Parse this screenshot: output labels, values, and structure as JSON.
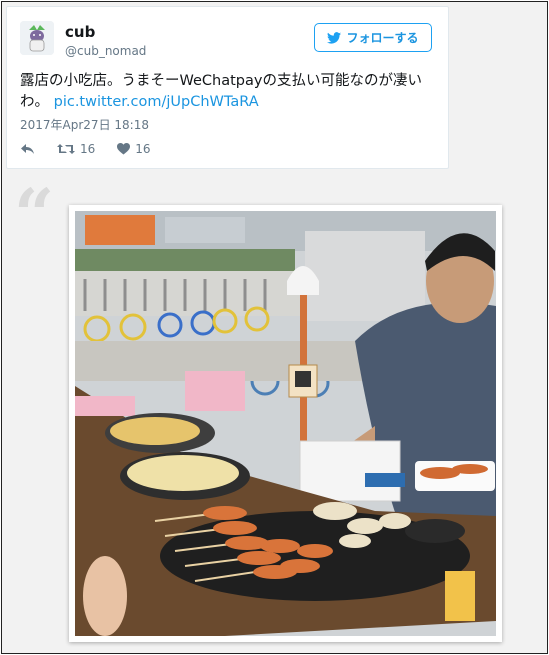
{
  "tweet": {
    "name": "cub",
    "handle": "@cub_nomad",
    "follow_label": "フォローする",
    "text": "露店の小吃店。うまそーWeChatpayの支払い可能なのが凄いわ。",
    "link": "pic.twitter.com/jUpChWTaRA",
    "date": "2017年Apr27日 18:18",
    "retweets": "16",
    "likes": "16"
  },
  "colors": {
    "accent": "#1da1f2",
    "link": "#1b95e0",
    "meta": "#657786"
  },
  "icons": [
    "bird-icon",
    "reply-icon",
    "retweet-icon",
    "heart-icon",
    "quote-icon"
  ]
}
